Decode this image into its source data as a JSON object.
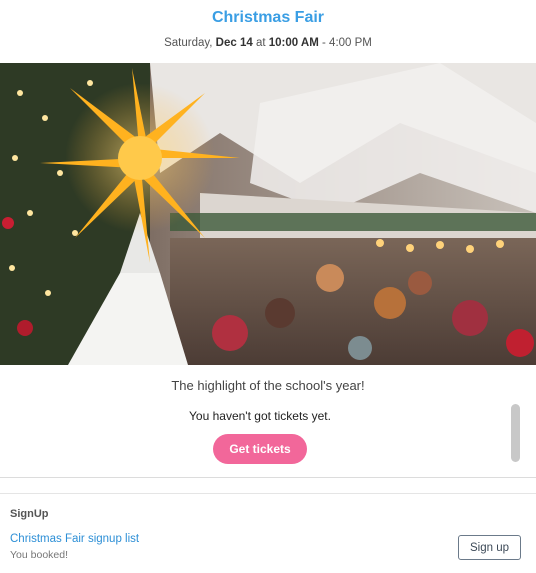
{
  "event": {
    "title": "Christmas Fair",
    "date_prefix": "Saturday, ",
    "date": "Dec 14",
    "date_at": " at ",
    "start_time": "10:00 AM",
    "end_time": " - 4:00 PM",
    "tagline": "The highlight of the school's year!"
  },
  "tickets": {
    "status": "You haven't got tickets yet.",
    "button_label": "Get tickets",
    "button_color": "#f2679a"
  },
  "signup": {
    "section_title": "SignUp",
    "list_link": "Christmas Fair signup list",
    "status": "You booked!",
    "button_label": "Sign up"
  },
  "colors": {
    "title": "#3a9ee4",
    "link": "#2d8fd6"
  }
}
